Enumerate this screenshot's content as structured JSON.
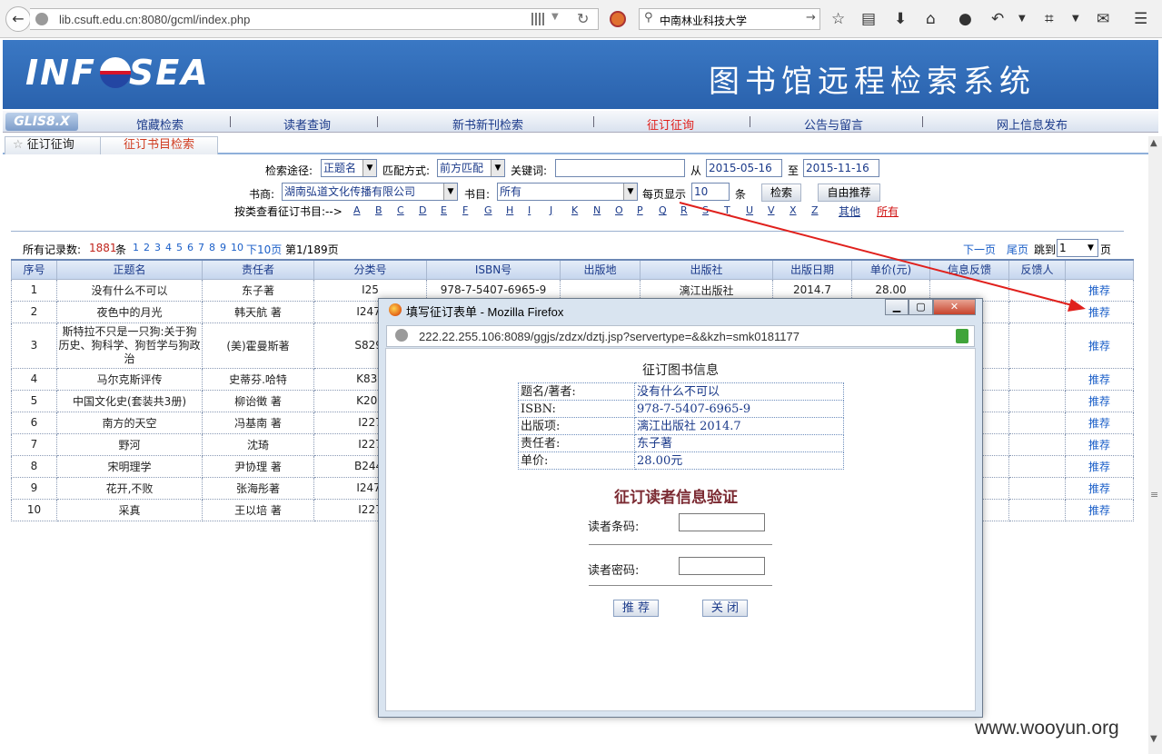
{
  "browser": {
    "url": "lib.csuft.edu.cn:8080/gcml/index.php",
    "search_query": "中南林业科技大学"
  },
  "site": {
    "logo_text": "INF SEA",
    "title": "图书馆远程检索系统",
    "version_badge": "GLIS8.X",
    "nav": [
      "馆藏检索",
      "读者查询",
      "新书新刊检索",
      "征订征询",
      "公告与留言",
      "网上信息发布"
    ],
    "nav_active": "征订征询",
    "tabs": [
      "征订征询",
      "征订书目检索"
    ]
  },
  "search_form": {
    "route_label": "检索途径:",
    "route_value": "正题名",
    "match_label": "匹配方式:",
    "match_value": "前方匹配",
    "keyword_label": "关键词:",
    "from_label": "从",
    "from_date": "2015-05-16",
    "to_label": "至",
    "to_date": "2015-11-16",
    "publisher_label": "书商:",
    "publisher_value": "湖南弘道文化传播有限公司",
    "catalog_label": "书目:",
    "catalog_value": "所有",
    "per_page_label": "每页显示",
    "per_page_value": "10",
    "per_page_unit": "条",
    "search_button": "检索",
    "recommend_button": "自由推荐",
    "browse_label": "按类查看征订书目:-->",
    "letters": [
      "A",
      "B",
      "C",
      "D",
      "E",
      "F",
      "G",
      "H",
      "I",
      "J",
      "K",
      "N",
      "O",
      "P",
      "Q",
      "R",
      "S",
      "T",
      "U",
      "V",
      "X",
      "Z"
    ],
    "other_link": "其他",
    "all_link": "所有"
  },
  "summary": {
    "total_label": "所有记录数:",
    "total_count": "1881",
    "count_unit": "条",
    "pages": [
      "1",
      "2",
      "3",
      "4",
      "5",
      "6",
      "7",
      "8",
      "9",
      "10"
    ],
    "next10": "下10页",
    "page_info": "第1/189页",
    "next_page": "下一页",
    "last_page": "尾页",
    "jump_label": "跳到",
    "jump_value": "1",
    "jump_unit": "页"
  },
  "table": {
    "headers": [
      "序号",
      "正题名",
      "责任者",
      "分类号",
      "ISBN号",
      "出版地",
      "出版社",
      "出版日期",
      "单价(元)",
      "信息反馈",
      "反馈人",
      ""
    ],
    "rows": [
      [
        "1",
        "没有什么不可以",
        "东子著",
        "I25",
        "978-7-5407-6965-9",
        "",
        "漓江出版社",
        "2014.7",
        "28.00",
        "",
        "",
        "推荐"
      ],
      [
        "2",
        "夜色中的月光",
        "韩天航 著",
        "I247.",
        "",
        "",
        "",
        "",
        "",
        "",
        "",
        "推荐"
      ],
      [
        "3",
        "斯特拉不只是一只狗:关于狗历史、狗科学、狗哲学与狗政治",
        "(美)霍曼斯著",
        "S829.",
        "",
        "",
        "",
        "",
        "",
        "",
        "",
        "推荐"
      ],
      [
        "4",
        "马尔克斯评传",
        "史蒂芬.哈特",
        "K837",
        "",
        "",
        "",
        "",
        "",
        "",
        "",
        "推荐"
      ],
      [
        "5",
        "中国文化史(套装共3册)",
        "柳诒徵 著",
        "K203",
        "",
        "",
        "",
        "",
        "",
        "",
        "",
        "推荐"
      ],
      [
        "6",
        "南方的天空",
        "冯基南 著",
        "I227",
        "",
        "",
        "",
        "",
        "",
        "",
        "",
        "推荐"
      ],
      [
        "7",
        "野河",
        "沈琦",
        "I227",
        "",
        "",
        "",
        "",
        "",
        "",
        "",
        "推荐"
      ],
      [
        "8",
        "宋明理学",
        "尹协理 著",
        "B244.",
        "",
        "",
        "",
        "",
        "",
        "",
        "",
        "推荐"
      ],
      [
        "9",
        "花开,不败",
        "张海彤著",
        "I247.",
        "",
        "",
        "",
        "",
        "",
        "",
        "",
        "推荐"
      ],
      [
        "10",
        "采真",
        "王以培 著",
        "I227",
        "",
        "",
        "",
        "",
        "",
        "",
        "",
        "推荐"
      ]
    ]
  },
  "dialog": {
    "title": "填写征订表单 - Mozilla Firefox",
    "url": "222.22.255.106:8089/ggjs/zdzx/dztj.jsp?servertype=&&kzh=smk0181177",
    "info_title": "征订图书信息",
    "info": [
      {
        "k": "题名/著者:",
        "v": "没有什么不可以"
      },
      {
        "k": "ISBN:",
        "v": "978-7-5407-6965-9"
      },
      {
        "k": "出版项:",
        "v": "漓江出版社  2014.7"
      },
      {
        "k": "责任者:",
        "v": "东子著"
      },
      {
        "k": "单价:",
        "v": "28.00元"
      }
    ],
    "verify_title": "征订读者信息验证",
    "barcode_label": "读者条码:",
    "password_label": "读者密码:",
    "recommend_button": "推 荐",
    "close_button": "关 闭"
  },
  "watermark": "www.wooyun.org"
}
